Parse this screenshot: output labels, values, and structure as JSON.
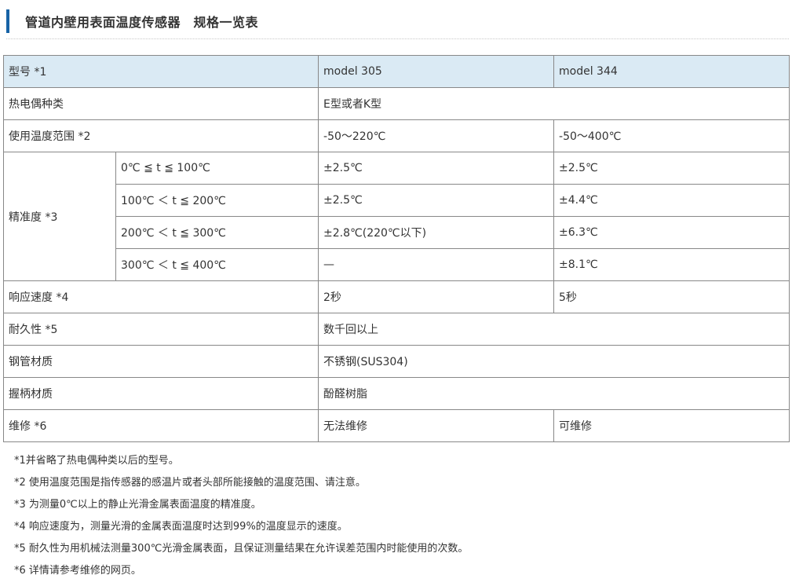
{
  "heading": {
    "title": "管道内壁用表面温度传感器　规格一览表"
  },
  "table": {
    "model_label": "型号 *1",
    "model_a": "model 305",
    "model_b": "model 344",
    "thermocouple_label": "热电偶种类",
    "thermocouple_value": "E型或者K型",
    "temp_range_label": "使用温度范围 *2",
    "temp_range_a": "-50～220℃",
    "temp_range_b": "-50～400℃",
    "accuracy_label": "精准度 *3",
    "accuracy_rows": [
      {
        "range": "0℃ ≦ t ≦ 100℃",
        "a": "±2.5℃",
        "b": "±2.5℃"
      },
      {
        "range": "100℃ ＜ t ≦ 200℃",
        "a": "±2.5℃",
        "b": "±4.4℃"
      },
      {
        "range": "200℃ ＜ t ≦ 300℃",
        "a": "±2.8℃(220℃以下)",
        "b": "±6.3℃"
      },
      {
        "range": "300℃ ＜ t ≦ 400℃",
        "a": "—",
        "b": "±8.1℃"
      }
    ],
    "response_label": "响应速度 *4",
    "response_a": "2秒",
    "response_b": "5秒",
    "durability_label": "耐久性 *5",
    "durability_value": "数千回以上",
    "pipe_label": "钢管材质",
    "pipe_value": "不锈钢(SUS304)",
    "handle_label": "握柄材质",
    "handle_value": "酚醛树脂",
    "repair_label": "维修 *6",
    "repair_a": "无法维修",
    "repair_b": "可维修"
  },
  "notes": [
    "*1并省略了热电偶种类以后的型号。",
    "*2 使用温度范围是指传感器的感温片或者头部所能接触的温度范围、请注意。",
    "*3 为测量0℃以上的静止光滑金属表面温度的精准度。",
    "*4 响应速度为，测量光滑的金属表面温度时达到99%的温度显示的速度。",
    "*5 耐久性为用机械法测量300℃光滑金属表面，且保证测量结果在允许误差范围内时能使用的次数。",
    "*6 详情请参考维修的网页。"
  ]
}
